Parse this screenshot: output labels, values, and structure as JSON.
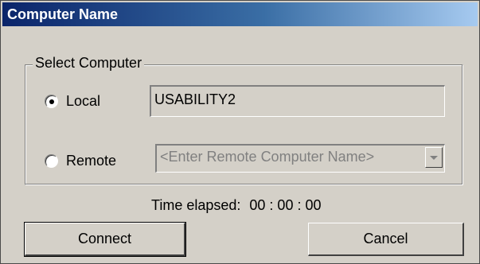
{
  "window": {
    "title": "Computer Name"
  },
  "group": {
    "label": "Select Computer",
    "local": {
      "label": "Local",
      "selected": true,
      "value": "USABILITY2"
    },
    "remote": {
      "label": "Remote",
      "selected": false,
      "placeholder": "<Enter Remote Computer Name>"
    }
  },
  "status": {
    "label": "Time elapsed:",
    "value": "00 : 00 : 00"
  },
  "buttons": {
    "connect": "Connect",
    "cancel": "Cancel"
  },
  "colors": {
    "face": "#d4d0c8",
    "titlebar_start": "#0a246a",
    "titlebar_end": "#a6caf0",
    "disabled_text": "#808080"
  },
  "icons": {
    "dropdown": "chevron-down-icon"
  }
}
